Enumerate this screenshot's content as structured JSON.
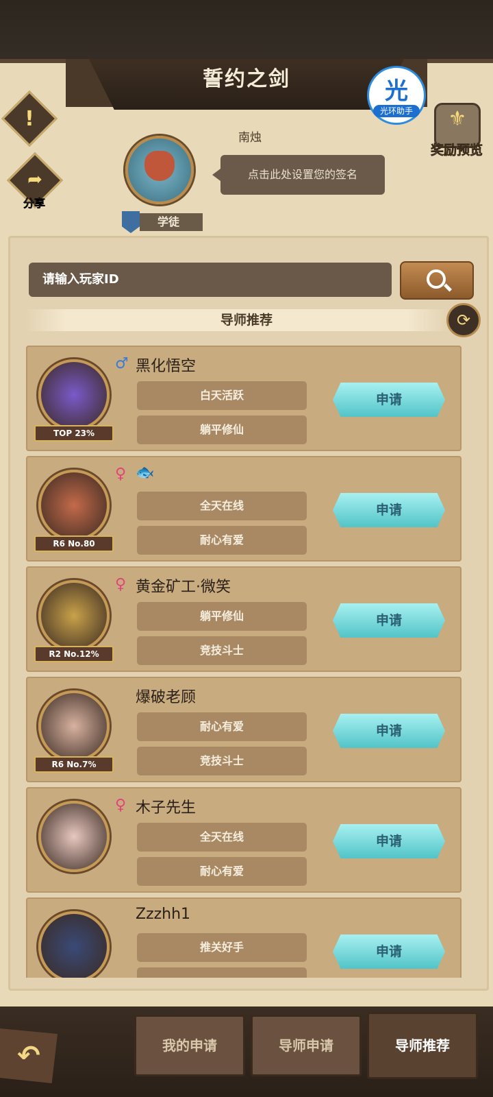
{
  "header": {
    "title": "誓约之剑"
  },
  "helper_badge": {
    "glyph": "光",
    "label": "光环助手"
  },
  "alert_icon": "exclamation-icon",
  "share": {
    "label": "分享"
  },
  "reward": {
    "label": "奖励预览"
  },
  "player": {
    "name": "南烛",
    "signature_placeholder": "点击此处设置您的签名",
    "rank": "学徒"
  },
  "search": {
    "placeholder": "请输入玩家ID"
  },
  "section": {
    "title": "导师推荐"
  },
  "apply_label": "申请",
  "mentors": [
    {
      "gender": "♂",
      "gender_color": "#3a7bd5",
      "name": "黑化悟空",
      "badge": "TOP 23%",
      "traits": [
        "白天活跃",
        "躺平修仙"
      ]
    },
    {
      "gender": "♀",
      "gender_color": "#e0457a",
      "name": "🐟",
      "badge": "R6 No.80",
      "traits": [
        "全天在线",
        "耐心有爱"
      ]
    },
    {
      "gender": "♀",
      "gender_color": "#e0457a",
      "name": "黄金矿工·微笑",
      "badge": "R2 No.12%",
      "traits": [
        "躺平修仙",
        "竞技斗士"
      ]
    },
    {
      "gender": "",
      "gender_color": "#e0457a",
      "name": "爆破老顾",
      "badge": "R6 No.7%",
      "traits": [
        "耐心有爱",
        "竞技斗士"
      ]
    },
    {
      "gender": "♀",
      "gender_color": "#e0457a",
      "name": "木子先生",
      "badge": "",
      "traits": [
        "全天在线",
        "耐心有爱"
      ]
    },
    {
      "gender": "",
      "gender_color": "#e0457a",
      "name": "Zzzhh1",
      "badge": "",
      "traits": [
        "推关好手",
        ""
      ]
    }
  ],
  "tabs": [
    {
      "label": "我的申请",
      "active": false
    },
    {
      "label": "导师申请",
      "active": false
    },
    {
      "label": "导师推荐",
      "active": true
    }
  ],
  "colors": {
    "accent": "#52c4c8",
    "board": "#e8d9b9",
    "row": "#c9ab80"
  }
}
